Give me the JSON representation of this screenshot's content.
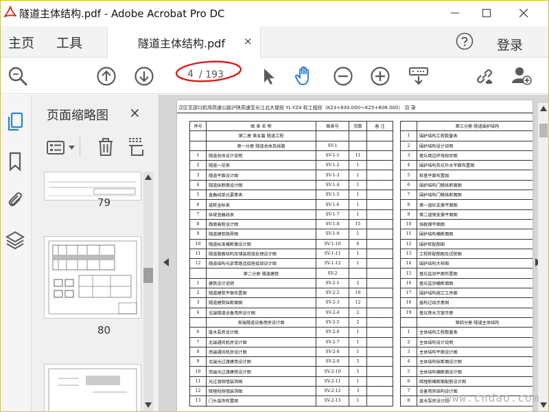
{
  "window": {
    "title": "隧道主体结构.pdf - Adobe Acrobat Pro DC",
    "app_logo_text": "ADOBE"
  },
  "menu": {
    "home": "主页",
    "tools": "工具",
    "login": "登录"
  },
  "tab": {
    "label": "隧道主体结构.pdf",
    "close": "×"
  },
  "toolbar": {
    "current_page": "4",
    "total_pages": "/ 193"
  },
  "thumbnail_panel": {
    "title": "页面缩略图",
    "close": "×",
    "pages": [
      "79",
      "80"
    ]
  },
  "document": {
    "header_text": "汉区至邵口机场高速公路沪陕高速至长江北大堤段 YL-YZ4 标工程段（K23+830.000～K25+608.000）  目    录",
    "left_table": {
      "headers": [
        "序号",
        "图    表    名    称",
        "图表号",
        "页数",
        "备  注"
      ],
      "rows": [
        [
          "",
          "第二册    第五篇    隧道工程",
          "",
          "",
          ""
        ],
        [
          "",
          "第一分册  隧道总体及线路",
          "SV-1",
          "",
          ""
        ],
        [
          "1",
          "隧道总体设计说明",
          "SV-1-1",
          "11",
          ""
        ],
        [
          "2",
          "隧道一览表",
          "SV-1-2",
          "1",
          ""
        ],
        [
          "3",
          "隧道平面设计图",
          "SV-1-3",
          "1",
          ""
        ],
        [
          "4",
          "隧道纵断面设计图",
          "SV-1-4",
          "1",
          ""
        ],
        [
          "5",
          "直曲线单元要素表",
          "SV-1-5",
          "1",
          ""
        ],
        [
          "6",
          "道桩坐标表",
          "SV-1-6",
          "1",
          ""
        ],
        [
          "7",
          "纵坡竖曲线表",
          "SV-1-7",
          "1",
          ""
        ],
        [
          "8",
          "路面高程设计图",
          "SV-1-8",
          "15",
          ""
        ],
        [
          "9",
          "隧道建筑限界图",
          "SV-1-9",
          "1",
          ""
        ],
        [
          "10",
          "隧道标准横断面设计图",
          "SV-1-10",
          "6",
          ""
        ],
        [
          "11",
          "隧道路面结构及铺装搭接处理设计图",
          "SV-1-11",
          "1",
          ""
        ],
        [
          "12",
          "隧道结构与邵青路连接搭接部设计图",
          "SV-1-12",
          "1",
          ""
        ],
        [
          "",
          "第二分册  隧道建筑",
          "SV-2",
          "",
          ""
        ],
        [
          "1",
          "建筑设计说明",
          "SV-2-1",
          "2",
          ""
        ],
        [
          "2",
          "隧道建筑平面布置图",
          "SV-2-2",
          "10",
          ""
        ],
        [
          "3",
          "隧道建筑纵断面图",
          "SV-2-3",
          "12",
          ""
        ],
        [
          "4",
          "北端隧道设备用房设计图",
          "SV-2-4",
          "2",
          ""
        ],
        [
          "",
          "南端隧道设备用房设计图",
          "SV-2-5",
          "2",
          ""
        ],
        [
          "6",
          "废水泵房设计图",
          "SV-2-6",
          "1",
          ""
        ],
        [
          "7",
          "北端通风机房设计图",
          "SV-2-7",
          "1",
          ""
        ],
        [
          "8",
          "南端通风机房设计图",
          "SV-2-8",
          "1",
          ""
        ],
        [
          "9",
          "北端光过渡建筑设计图",
          "SV-2-9",
          "5",
          ""
        ],
        [
          "10",
          "南端光过渡建筑设计图",
          "SV-2-10",
          "5",
          ""
        ],
        [
          "11",
          "光过渡侧墙装饰图",
          "SV-2-11",
          "1",
          ""
        ],
        [
          "12",
          "暗埋段侧墙装饰图",
          "SV-2-12",
          "3",
          ""
        ],
        [
          "13",
          "门头装饰布置图",
          "SV-2-13",
          "1",
          ""
        ]
      ]
    },
    "right_table": {
      "header": "第三分册  隧道围护结构",
      "rows": [
        [
          "1",
          "围护结构工程数量表"
        ],
        [
          "2",
          "围护结构设计说明"
        ],
        [
          "3",
          "基坑周边环境现状图"
        ],
        [
          "4",
          "围护结构及坑外水平面布置图"
        ],
        [
          "5",
          "桩基平面布置图"
        ],
        [
          "6",
          "围护结构门幔纵断面图"
        ],
        [
          "7",
          "围护结构门幔纵断面图"
        ],
        [
          "8",
          "第一道砼支撑平面图"
        ],
        [
          "9",
          "第二道钢支撑平面图"
        ],
        [
          "10",
          "挡板撑平面图"
        ],
        [
          "11",
          "围护结构横断面图"
        ],
        [
          "12",
          "围护桩配筋图"
        ],
        [
          "13",
          "工程桩配筋图及试桩图"
        ],
        [
          "14",
          "围护结构大样图"
        ],
        [
          "15",
          "基坑监测平面布置图"
        ],
        [
          "16",
          "基坑监测横断面图"
        ],
        [
          "17",
          "围护结构施工工序图"
        ],
        [
          "18",
          "盾构过线示意图"
        ],
        [
          "19",
          "基坑降水方案示意"
        ],
        [
          "",
          "第四分册  隧道主体结构"
        ],
        [
          "1",
          "主体结构工程数量表"
        ],
        [
          "2",
          "主体结构设计说明"
        ],
        [
          "3",
          "主体结构平面设计图"
        ],
        [
          "4",
          "主体结构纵断面设计图"
        ],
        [
          "5",
          "主体结构横断面设计图"
        ],
        [
          "6",
          "暗埋断横断面配筋设计图"
        ],
        [
          "7",
          "设备用房结构设计图"
        ],
        [
          "8",
          "废水泵房设计图"
        ]
      ]
    },
    "watermark": "www.cndao.com"
  },
  "colors": {
    "accent": "#2d7fd3",
    "annotation": "#e01a1a",
    "icon": "#5a5a5a"
  }
}
